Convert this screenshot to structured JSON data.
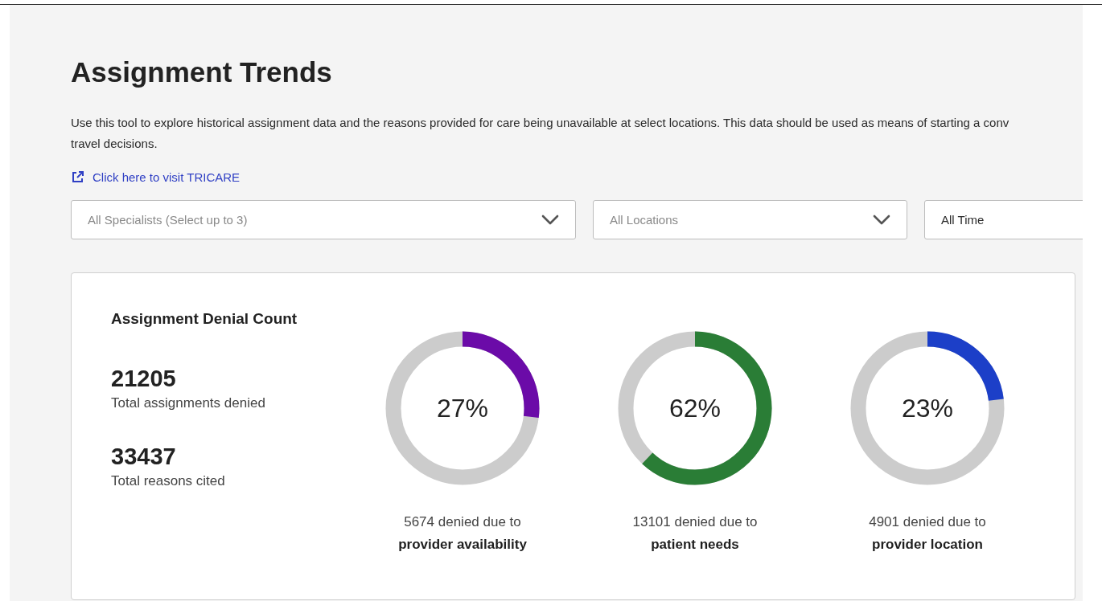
{
  "title": "Assignment Trends",
  "description": "Use this tool to explore historical assignment data and the reasons provided for care being unavailable at select locations. This data should be used as means of starting a conv\ntravel decisions.",
  "link": {
    "label": "Click here to visit TRICARE"
  },
  "filters": [
    {
      "placeholder": "All Specialists (Select up to 3)"
    },
    {
      "placeholder": "All Locations"
    },
    {
      "value": "All Time"
    }
  ],
  "card": {
    "heading": "Assignment Denial Count",
    "stats": [
      {
        "value": "21205",
        "label": "Total assignments denied"
      },
      {
        "value": "33437",
        "label": "Total reasons cited"
      }
    ],
    "donuts": [
      {
        "percent": "27%",
        "color": "#6b0ba8",
        "caption": "5674 denied due to",
        "reason": "provider availability"
      },
      {
        "percent": "62%",
        "color": "#2a7d36",
        "caption": "13101 denied due to",
        "reason": "patient needs"
      },
      {
        "percent": "23%",
        "color": "#1c3fc8",
        "caption": "4901 denied due to",
        "reason": "provider location"
      }
    ]
  }
}
